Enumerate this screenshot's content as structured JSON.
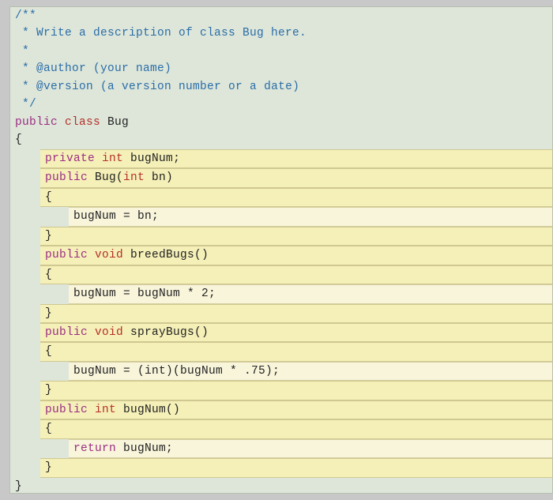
{
  "comment": {
    "l1": "/**",
    "l2": " * Write a description of class Bug here.",
    "l3": " *",
    "l4_a": " * @author ",
    "l4_b": "(your name)",
    "l5_a": " * @version ",
    "l5_b": "(a version number or a date)",
    "l6": " */"
  },
  "kw_public": "public",
  "kw_private": "private",
  "kw_class": "class",
  "kw_void": "void",
  "kw_int": "int",
  "kw_return": "return",
  "class_name": " Bug",
  "field_name": " bugNum",
  "semi": ";",
  "lbrace": "{",
  "rbrace": "}",
  "ctor_sig_a": " Bug(",
  "ctor_sig_b": " bn)",
  "ctor_body": "bugNum = bn;",
  "breed_name": " breedBugs()",
  "breed_body": "bugNum = bugNum * 2;",
  "spray_name": " sprayBugs()",
  "spray_body": "bugNum = (int)(bugNum * .75);",
  "getter_name": " bugNum()",
  "getter_body_a": "return",
  "getter_body_b": " bugNum;"
}
